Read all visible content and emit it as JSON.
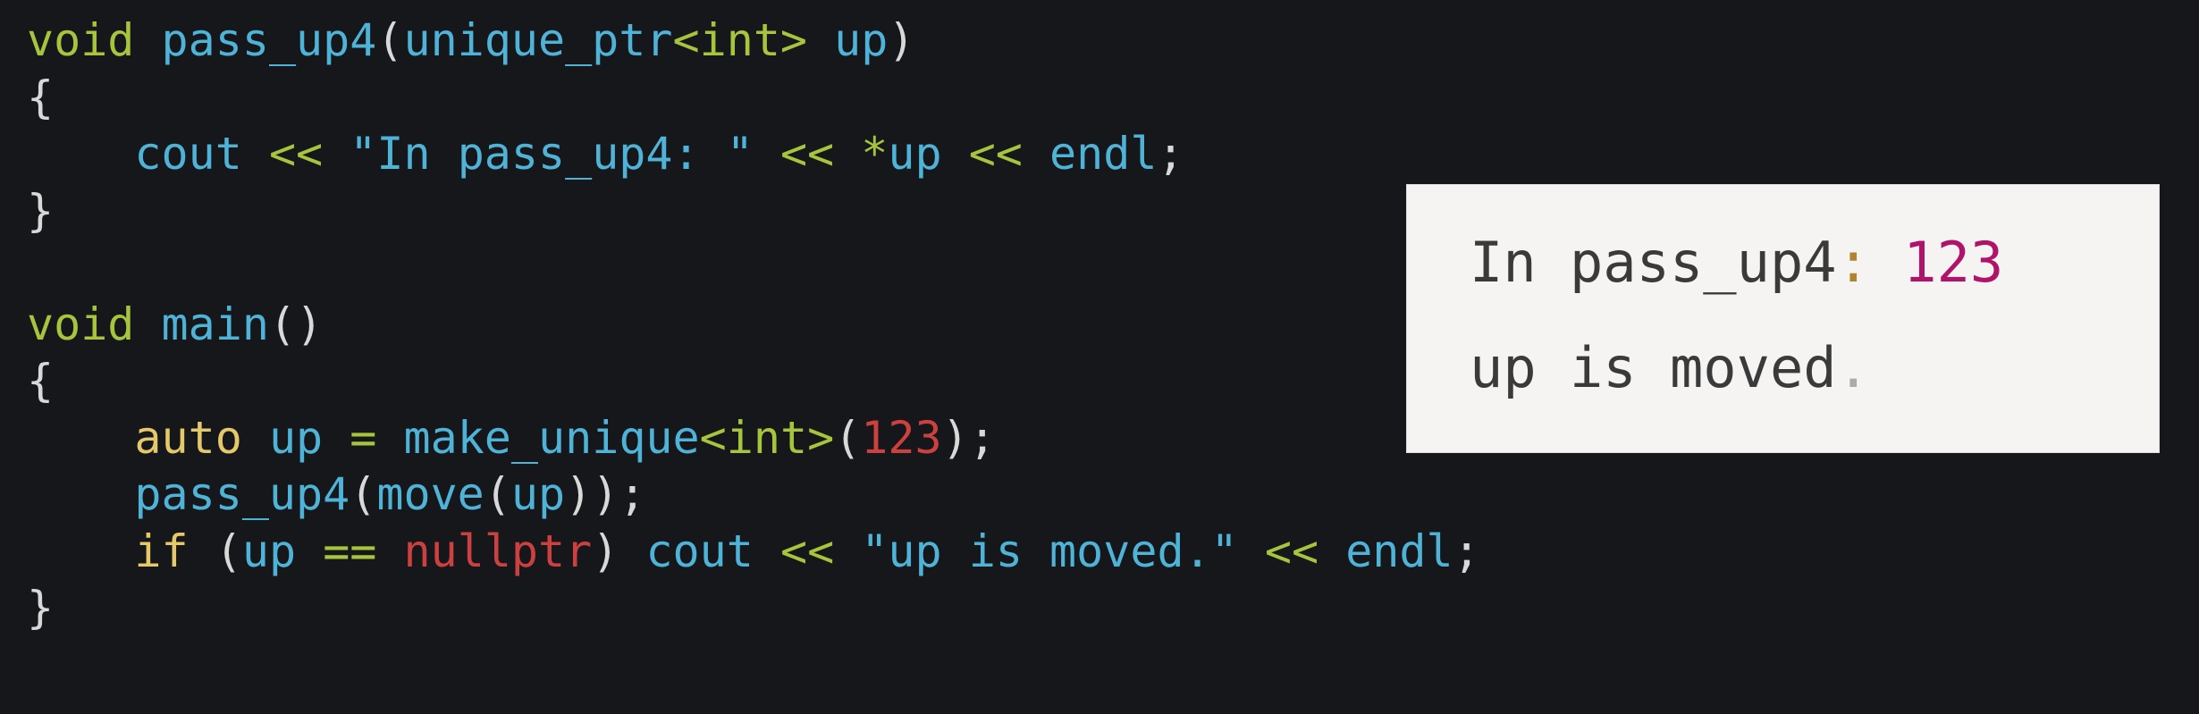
{
  "colors": {
    "background": "#16171b",
    "keyword_green": "#a6c53d",
    "identifier_blue": "#4eb3d6",
    "keyword_yellow": "#e5c86a",
    "literal_red": "#cc4040",
    "plain": "#d8d8d8",
    "popup_bg": "#f5f4f2",
    "popup_text": "#3a3a3a",
    "popup_number": "#b0136a",
    "popup_colon": "#b08330"
  },
  "code_lines": [
    [
      {
        "t": "void",
        "c": "#a6c53d"
      },
      {
        "t": " ",
        "c": "#d8d8d8"
      },
      {
        "t": "pass_up4",
        "c": "#4eb3d6"
      },
      {
        "t": "(",
        "c": "#d8d8d8"
      },
      {
        "t": "unique_ptr",
        "c": "#4eb3d6"
      },
      {
        "t": "<",
        "c": "#a6c53d"
      },
      {
        "t": "int",
        "c": "#a6c53d"
      },
      {
        "t": ">",
        "c": "#a6c53d"
      },
      {
        "t": " ",
        "c": "#d8d8d8"
      },
      {
        "t": "up",
        "c": "#4eb3d6"
      },
      {
        "t": ")",
        "c": "#d8d8d8"
      }
    ],
    [
      {
        "t": "{",
        "c": "#d8d8d8"
      }
    ],
    [
      {
        "t": "    ",
        "c": "#d8d8d8"
      },
      {
        "t": "cout",
        "c": "#4eb3d6"
      },
      {
        "t": " ",
        "c": "#d8d8d8"
      },
      {
        "t": "<<",
        "c": "#a6c53d"
      },
      {
        "t": " ",
        "c": "#d8d8d8"
      },
      {
        "t": "\"In pass_up4: \"",
        "c": "#4eb3d6"
      },
      {
        "t": " ",
        "c": "#d8d8d8"
      },
      {
        "t": "<<",
        "c": "#a6c53d"
      },
      {
        "t": " ",
        "c": "#d8d8d8"
      },
      {
        "t": "*",
        "c": "#a6c53d"
      },
      {
        "t": "up",
        "c": "#4eb3d6"
      },
      {
        "t": " ",
        "c": "#d8d8d8"
      },
      {
        "t": "<<",
        "c": "#a6c53d"
      },
      {
        "t": " ",
        "c": "#d8d8d8"
      },
      {
        "t": "endl",
        "c": "#4eb3d6"
      },
      {
        "t": ";",
        "c": "#d8d8d8"
      }
    ],
    [
      {
        "t": "}",
        "c": "#d8d8d8"
      }
    ],
    [],
    [
      {
        "t": "void",
        "c": "#a6c53d"
      },
      {
        "t": " ",
        "c": "#d8d8d8"
      },
      {
        "t": "main",
        "c": "#4eb3d6"
      },
      {
        "t": "()",
        "c": "#d8d8d8"
      }
    ],
    [
      {
        "t": "{",
        "c": "#d8d8d8"
      }
    ],
    [
      {
        "t": "    ",
        "c": "#d8d8d8"
      },
      {
        "t": "auto",
        "c": "#e5c86a"
      },
      {
        "t": " ",
        "c": "#d8d8d8"
      },
      {
        "t": "up",
        "c": "#4eb3d6"
      },
      {
        "t": " ",
        "c": "#d8d8d8"
      },
      {
        "t": "=",
        "c": "#a6c53d"
      },
      {
        "t": " ",
        "c": "#d8d8d8"
      },
      {
        "t": "make_unique",
        "c": "#4eb3d6"
      },
      {
        "t": "<",
        "c": "#a6c53d"
      },
      {
        "t": "int",
        "c": "#a6c53d"
      },
      {
        "t": ">",
        "c": "#a6c53d"
      },
      {
        "t": "(",
        "c": "#d8d8d8"
      },
      {
        "t": "123",
        "c": "#cc4040"
      },
      {
        "t": ");",
        "c": "#d8d8d8"
      }
    ],
    [
      {
        "t": "    ",
        "c": "#d8d8d8"
      },
      {
        "t": "pass_up4",
        "c": "#4eb3d6"
      },
      {
        "t": "(",
        "c": "#d8d8d8"
      },
      {
        "t": "move",
        "c": "#4eb3d6"
      },
      {
        "t": "(",
        "c": "#d8d8d8"
      },
      {
        "t": "up",
        "c": "#4eb3d6"
      },
      {
        "t": "));",
        "c": "#d8d8d8"
      }
    ],
    [
      {
        "t": "    ",
        "c": "#d8d8d8"
      },
      {
        "t": "if",
        "c": "#e5c86a"
      },
      {
        "t": " (",
        "c": "#d8d8d8"
      },
      {
        "t": "up",
        "c": "#4eb3d6"
      },
      {
        "t": " ",
        "c": "#d8d8d8"
      },
      {
        "t": "==",
        "c": "#a6c53d"
      },
      {
        "t": " ",
        "c": "#d8d8d8"
      },
      {
        "t": "nullptr",
        "c": "#cc4040"
      },
      {
        "t": ") ",
        "c": "#d8d8d8"
      },
      {
        "t": "cout",
        "c": "#4eb3d6"
      },
      {
        "t": " ",
        "c": "#d8d8d8"
      },
      {
        "t": "<<",
        "c": "#a6c53d"
      },
      {
        "t": " ",
        "c": "#d8d8d8"
      },
      {
        "t": "\"up is moved.\"",
        "c": "#4eb3d6"
      },
      {
        "t": " ",
        "c": "#d8d8d8"
      },
      {
        "t": "<<",
        "c": "#a6c53d"
      },
      {
        "t": " ",
        "c": "#d8d8d8"
      },
      {
        "t": "endl",
        "c": "#4eb3d6"
      },
      {
        "t": ";",
        "c": "#d8d8d8"
      }
    ],
    [
      {
        "t": "}",
        "c": "#d8d8d8"
      }
    ]
  ],
  "output": {
    "line1_prefix": "In pass_up4",
    "line1_colon": ":",
    "line1_space": " ",
    "line1_value": "123",
    "line2_text": "up is moved",
    "line2_period": "."
  }
}
